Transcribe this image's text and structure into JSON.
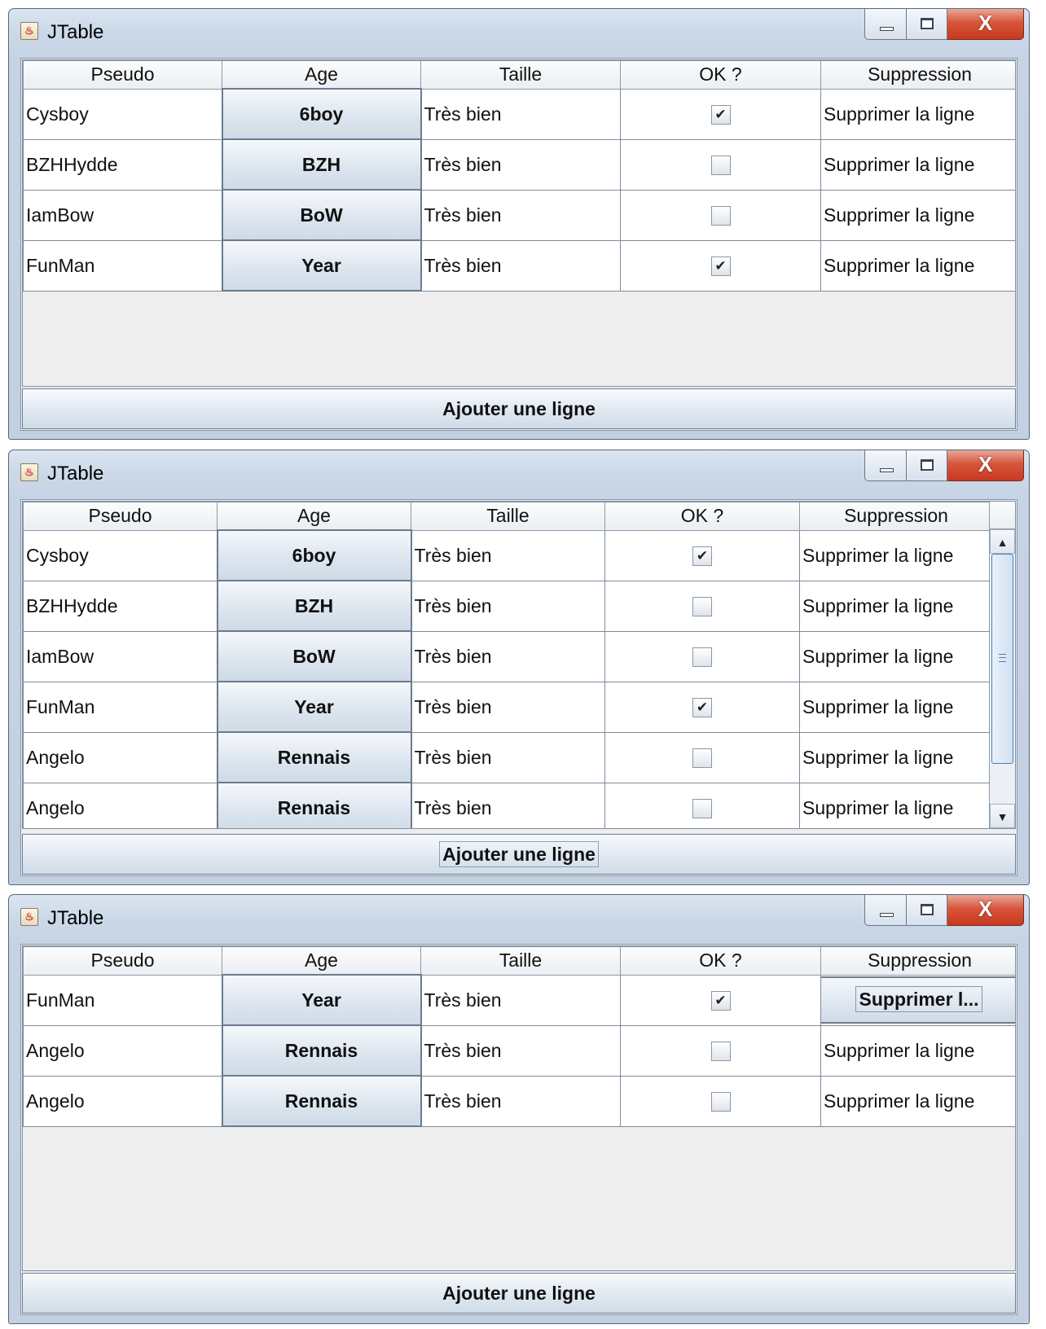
{
  "windows": [
    {
      "title": "JTable",
      "columns": [
        "Pseudo",
        "Age",
        "Taille",
        "OK ?",
        "Suppression"
      ],
      "rows": [
        {
          "pseudo": "Cysboy",
          "age": "6boy",
          "taille": "Très bien",
          "ok": true,
          "suppression": "Supprimer la ligne"
        },
        {
          "pseudo": "BZHHydde",
          "age": "BZH",
          "taille": "Très bien",
          "ok": false,
          "suppression": "Supprimer la ligne"
        },
        {
          "pseudo": "IamBow",
          "age": "BoW",
          "taille": "Très bien",
          "ok": false,
          "suppression": "Supprimer la ligne"
        },
        {
          "pseudo": "FunMan",
          "age": "Year",
          "taille": "Très bien",
          "ok": true,
          "suppression": "Supprimer la ligne"
        }
      ],
      "add_button": "Ajouter une ligne"
    },
    {
      "title": "JTable",
      "columns": [
        "Pseudo",
        "Age",
        "Taille",
        "OK ?",
        "Suppression"
      ],
      "rows": [
        {
          "pseudo": "Cysboy",
          "age": "6boy",
          "taille": "Très bien",
          "ok": true,
          "suppression": "Supprimer la ligne"
        },
        {
          "pseudo": "BZHHydde",
          "age": "BZH",
          "taille": "Très bien",
          "ok": false,
          "suppression": "Supprimer la ligne"
        },
        {
          "pseudo": "IamBow",
          "age": "BoW",
          "taille": "Très bien",
          "ok": false,
          "suppression": "Supprimer la ligne"
        },
        {
          "pseudo": "FunMan",
          "age": "Year",
          "taille": "Très bien",
          "ok": true,
          "suppression": "Supprimer la ligne"
        },
        {
          "pseudo": "Angelo",
          "age": "Rennais",
          "taille": "Très bien",
          "ok": false,
          "suppression": "Supprimer la ligne"
        },
        {
          "pseudo": "Angelo",
          "age": "Rennais",
          "taille": "Très bien",
          "ok": false,
          "suppression": "Supprimer la ligne"
        }
      ],
      "add_button": "Ajouter une ligne"
    },
    {
      "title": "JTable",
      "columns": [
        "Pseudo",
        "Age",
        "Taille",
        "OK ?",
        "Suppression"
      ],
      "rows": [
        {
          "pseudo": "FunMan",
          "age": "Year",
          "taille": "Très bien",
          "ok": true,
          "suppression": "Supprimer l..."
        },
        {
          "pseudo": "Angelo",
          "age": "Rennais",
          "taille": "Très bien",
          "ok": false,
          "suppression": "Supprimer la ligne"
        },
        {
          "pseudo": "Angelo",
          "age": "Rennais",
          "taille": "Très bien",
          "ok": false,
          "suppression": "Supprimer la ligne"
        }
      ],
      "add_button": "Ajouter une ligne"
    }
  ],
  "check_glyph": "✔",
  "scroll_up_glyph": "▲",
  "scroll_down_glyph": "▼",
  "close_glyph": "X"
}
